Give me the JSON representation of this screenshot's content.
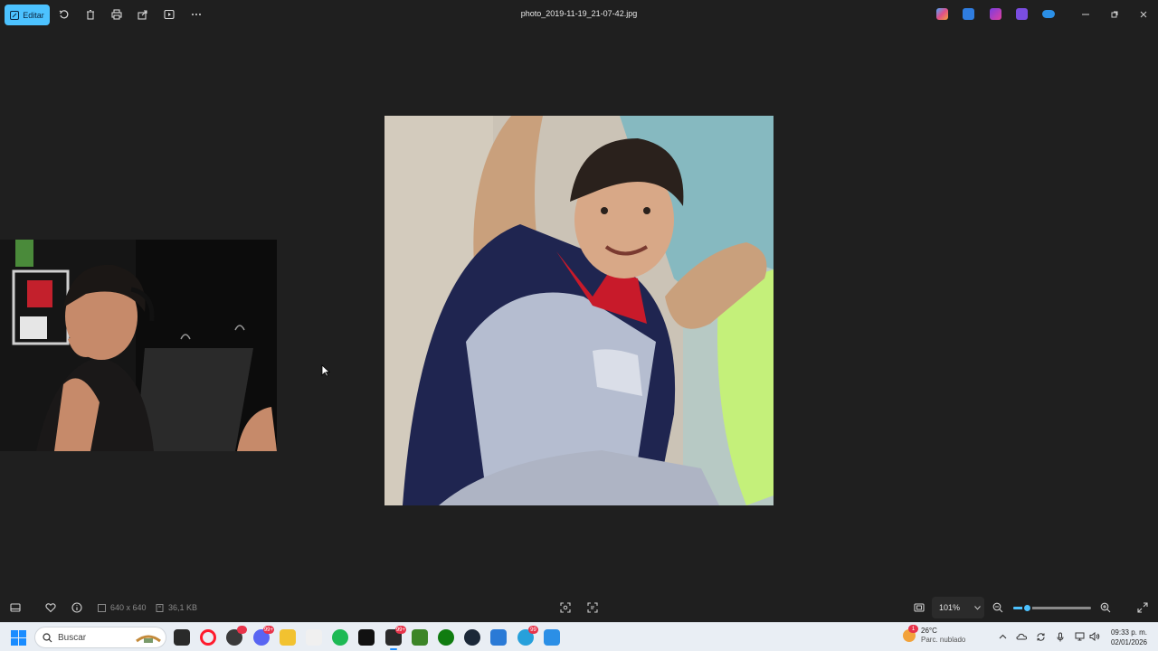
{
  "toolbar": {
    "edit_label": "Editar",
    "icons": [
      "edit-icon",
      "rotate-icon",
      "delete-icon",
      "print-icon",
      "share-icon",
      "slideshow-icon",
      "more-icon"
    ]
  },
  "window": {
    "title": "photo_2019-11-19_21-07-42.jpg",
    "controls": [
      "minimize-icon",
      "restore-icon",
      "close-icon"
    ]
  },
  "top_apps": [
    {
      "name": "copilot-icon",
      "color": "#e04e8a"
    },
    {
      "name": "designer-icon",
      "color": "#2f7de0"
    },
    {
      "name": "clipchamp-icon",
      "color": "#c03ad0"
    },
    {
      "name": "clipchamp-alt-icon",
      "color": "#7a4de0"
    },
    {
      "name": "onedrive-icon",
      "color": "#2b8fe6"
    }
  ],
  "image": {
    "dimensions": "640 x 640",
    "file_size": "36,1 KB"
  },
  "zoom": {
    "value": "101%",
    "level_fraction": 0.17
  },
  "taskbar": {
    "search_placeholder": "Buscar",
    "apps": [
      {
        "name": "task-view-icon",
        "color": "#2a2a2a"
      },
      {
        "name": "opera-icon",
        "color": "#ff1b2d"
      },
      {
        "name": "chrome-canary-icon",
        "color": "#3a3a3a",
        "badge": ""
      },
      {
        "name": "discord-icon",
        "color": "#5865f2",
        "badge": "99+"
      },
      {
        "name": "file-explorer-icon",
        "color": "#f2c230"
      },
      {
        "name": "x-icon",
        "color": "#f0f0f0"
      },
      {
        "name": "spotify-icon",
        "color": "#1db954"
      },
      {
        "name": "capcut-icon",
        "color": "#111111"
      },
      {
        "name": "obs-icon",
        "color": "#2a2a2a",
        "badge": "99+"
      },
      {
        "name": "minecraft-icon",
        "color": "#3c8527"
      },
      {
        "name": "xbox-icon",
        "color": "#107c10"
      },
      {
        "name": "steam-icon",
        "color": "#1b2838"
      },
      {
        "name": "notepad-icon",
        "color": "#2a7ad6"
      },
      {
        "name": "telegram-icon",
        "color": "#27a0db",
        "badge": "99"
      },
      {
        "name": "photos-icon",
        "color": "#2b8fe6"
      }
    ],
    "weather": {
      "temp": "26°C",
      "condition": "Parc. nublado",
      "alert": "1"
    },
    "clock": {
      "time": "09:33 p. m.",
      "date": "02/01/2026"
    }
  }
}
